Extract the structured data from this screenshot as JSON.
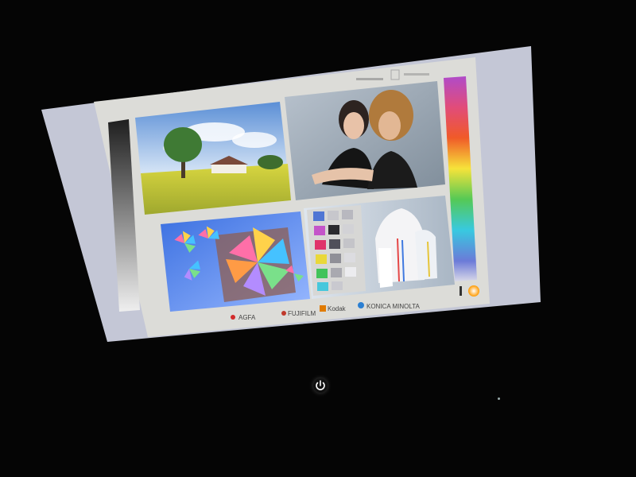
{
  "scene": {
    "description_label": "",
    "brands": [
      {
        "name": "AGFA",
        "color": "#d22b2b"
      },
      {
        "name": "FUJIFILM",
        "color": "#c0392b"
      },
      {
        "name": "Kodak",
        "color": "#e07b00"
      },
      {
        "name": "KONICA MINOLTA",
        "color": "#2b7fd2"
      }
    ],
    "colors": {
      "background": "#050505",
      "screen_frame": "#c9ccd8",
      "screen_inner": "#e6e6e2",
      "gray_ramp_top": "#2a2a2a",
      "gray_ramp_bottom": "#e6e6e6"
    },
    "icons": [
      "power-icon"
    ]
  }
}
